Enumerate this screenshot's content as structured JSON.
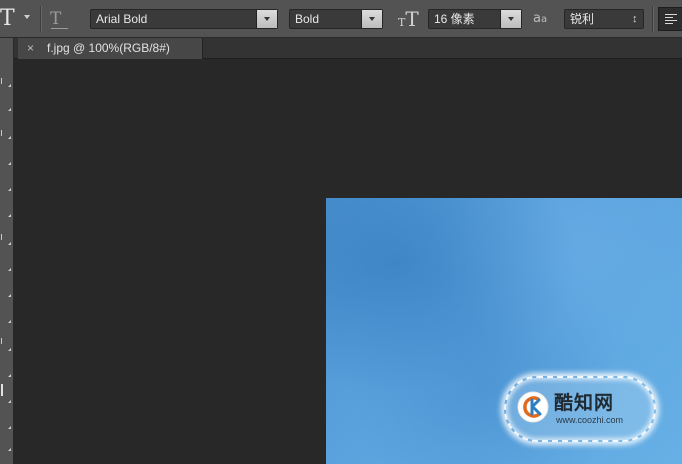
{
  "options_bar": {
    "tool_icon": "T",
    "font_family": "Arial Bold",
    "font_style": "Bold",
    "font_size": "16 像素",
    "anti_alias": "锐利"
  },
  "icons": {
    "text_tool": "text-tool-icon",
    "orientation": "text-orientation-icon",
    "font_size": "font-size-icon",
    "anti_alias": "anti-alias-icon",
    "align_left": "align-left-icon"
  },
  "document": {
    "tab_close": "×",
    "tab_title": "f.jpg @ 100%(RGB/8#)"
  },
  "watermark": {
    "brand": "酷知网",
    "url": "www.coozhi.com"
  },
  "colors": {
    "toolbar_bg": "#535353",
    "workspace_bg": "#282828",
    "image_blue": "#5aa3de"
  }
}
